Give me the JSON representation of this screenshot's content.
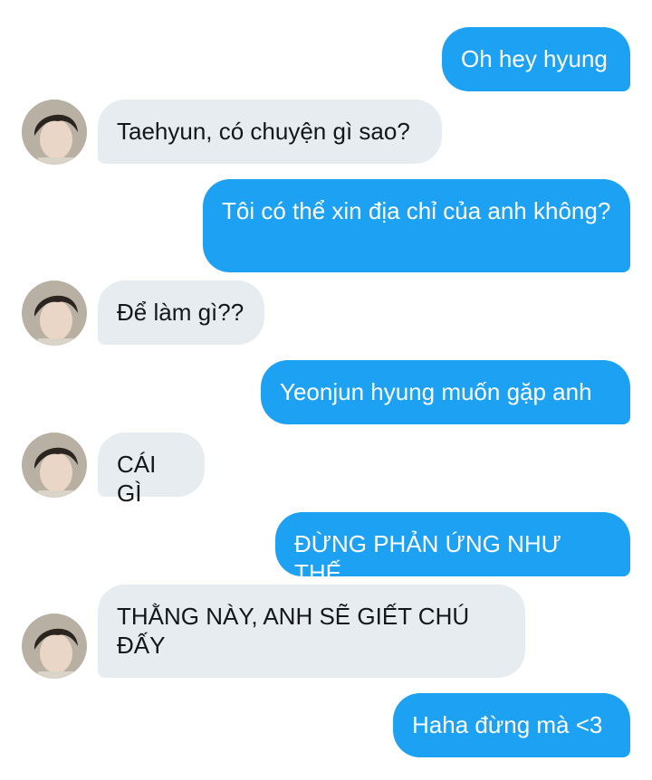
{
  "messages": [
    {
      "side": "out",
      "text": "Oh hey hyung"
    },
    {
      "side": "in",
      "text": "Taehyun, có chuyện gì sao?"
    },
    {
      "side": "out",
      "text": "Tôi có thể xin địa chỉ của anh không?"
    },
    {
      "side": "in",
      "text": "Để làm gì??"
    },
    {
      "side": "out",
      "text": "Yeonjun hyung muốn gặp anh"
    },
    {
      "side": "in",
      "text": "CÁI GÌ"
    },
    {
      "side": "out",
      "text": "ĐỪNG PHẢN ỨNG NHƯ THẾ"
    },
    {
      "side": "in",
      "text": "THẰNG NÀY, ANH SẼ GIẾT CHÚ ĐẤY"
    },
    {
      "side": "out",
      "text": "Haha đừng mà <3"
    }
  ],
  "colors": {
    "outgoing_bubble": "#1da1f2",
    "incoming_bubble": "#e6ecf0",
    "incoming_text": "#14171a",
    "outgoing_text": "#ffffff"
  },
  "avatar_icon": "user-avatar-photo"
}
